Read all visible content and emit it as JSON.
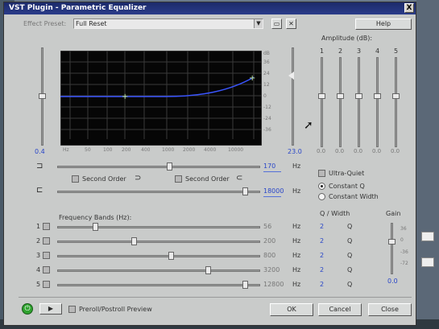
{
  "window": {
    "title": "VST Plugin - Parametric Equalizer",
    "close": "X"
  },
  "preset": {
    "label": "Effect Preset:",
    "value": "Full Reset",
    "help": "Help"
  },
  "graph": {
    "y_labels_right": [
      "dB",
      "36",
      "24",
      "12",
      "0",
      "-12",
      "-24",
      "-36"
    ],
    "x_labels": [
      "Hz",
      "50",
      "100",
      "200",
      "400",
      "1000",
      "2000",
      "4000",
      "10000"
    ],
    "left_slider_value": "0.4",
    "right_slider_value": "23.0"
  },
  "filters": {
    "low": {
      "value": "170",
      "unit": "Hz"
    },
    "high": {
      "value": "18000",
      "unit": "Hz"
    },
    "second_order_1": "Second Order",
    "second_order_2": "Second Order"
  },
  "amplitude": {
    "label": "Amplitude (dB):",
    "bands": [
      {
        "num": "1",
        "value": "0.0"
      },
      {
        "num": "2",
        "value": "0.0"
      },
      {
        "num": "3",
        "value": "0.0"
      },
      {
        "num": "4",
        "value": "0.0"
      },
      {
        "num": "5",
        "value": "0.0"
      }
    ]
  },
  "options": {
    "ultra_quiet": "Ultra-Quiet",
    "constant_q": "Constant Q",
    "constant_width": "Constant Width",
    "selected": "constant_q"
  },
  "freq_bands": {
    "label": "Frequency Bands (Hz):",
    "unit": "Hz",
    "rows": [
      {
        "num": "1",
        "value": "56",
        "level": 0.18
      },
      {
        "num": "2",
        "value": "200",
        "level": 0.38
      },
      {
        "num": "3",
        "value": "800",
        "level": 0.57
      },
      {
        "num": "4",
        "value": "3200",
        "level": 0.76
      },
      {
        "num": "5",
        "value": "12800",
        "level": 0.95
      }
    ]
  },
  "q_width": {
    "label": "Q / Width",
    "rows": [
      {
        "value": "2",
        "unit": "Q"
      },
      {
        "value": "2",
        "unit": "Q"
      },
      {
        "value": "2",
        "unit": "Q"
      },
      {
        "value": "2",
        "unit": "Q"
      },
      {
        "value": "2",
        "unit": "Q"
      }
    ]
  },
  "gain": {
    "label": "Gain",
    "ticks": [
      "36",
      "0",
      "-36",
      "-72"
    ],
    "value": "0.0"
  },
  "bottom": {
    "preview": "Preroll/Postroll Preview",
    "ok": "OK",
    "cancel": "Cancel",
    "close": "Close"
  }
}
